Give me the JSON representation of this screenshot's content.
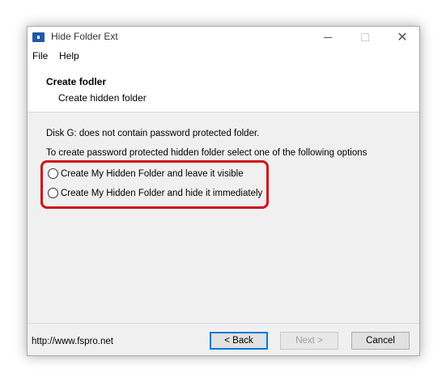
{
  "window": {
    "title": "Hide Folder Ext",
    "close_glyph": "✕"
  },
  "menu": {
    "file": "File",
    "help": "Help"
  },
  "header": {
    "title": "Create fodler",
    "subtitle": "Create hidden folder"
  },
  "body": {
    "info1": "Disk G: does not contain password protected folder.",
    "info2": "To create password protected hidden folder select one of the following options",
    "options": [
      {
        "label": "Create My Hidden Folder and leave it visible",
        "selected": false
      },
      {
        "label": "Create My Hidden Folder and hide it immediately",
        "selected": false
      }
    ]
  },
  "footer": {
    "url": "http://www.fspro.net",
    "back_label": "< Back",
    "next_label": "Next >",
    "cancel_label": "Cancel"
  },
  "colors": {
    "highlight": "#d0101a",
    "focus_border": "#0078d7",
    "window_bg": "#f0f0f0"
  },
  "icons": {
    "app": "lock-folder-icon",
    "minimize": "minimize-icon",
    "maximize": "maximize-icon",
    "close": "close-icon"
  }
}
